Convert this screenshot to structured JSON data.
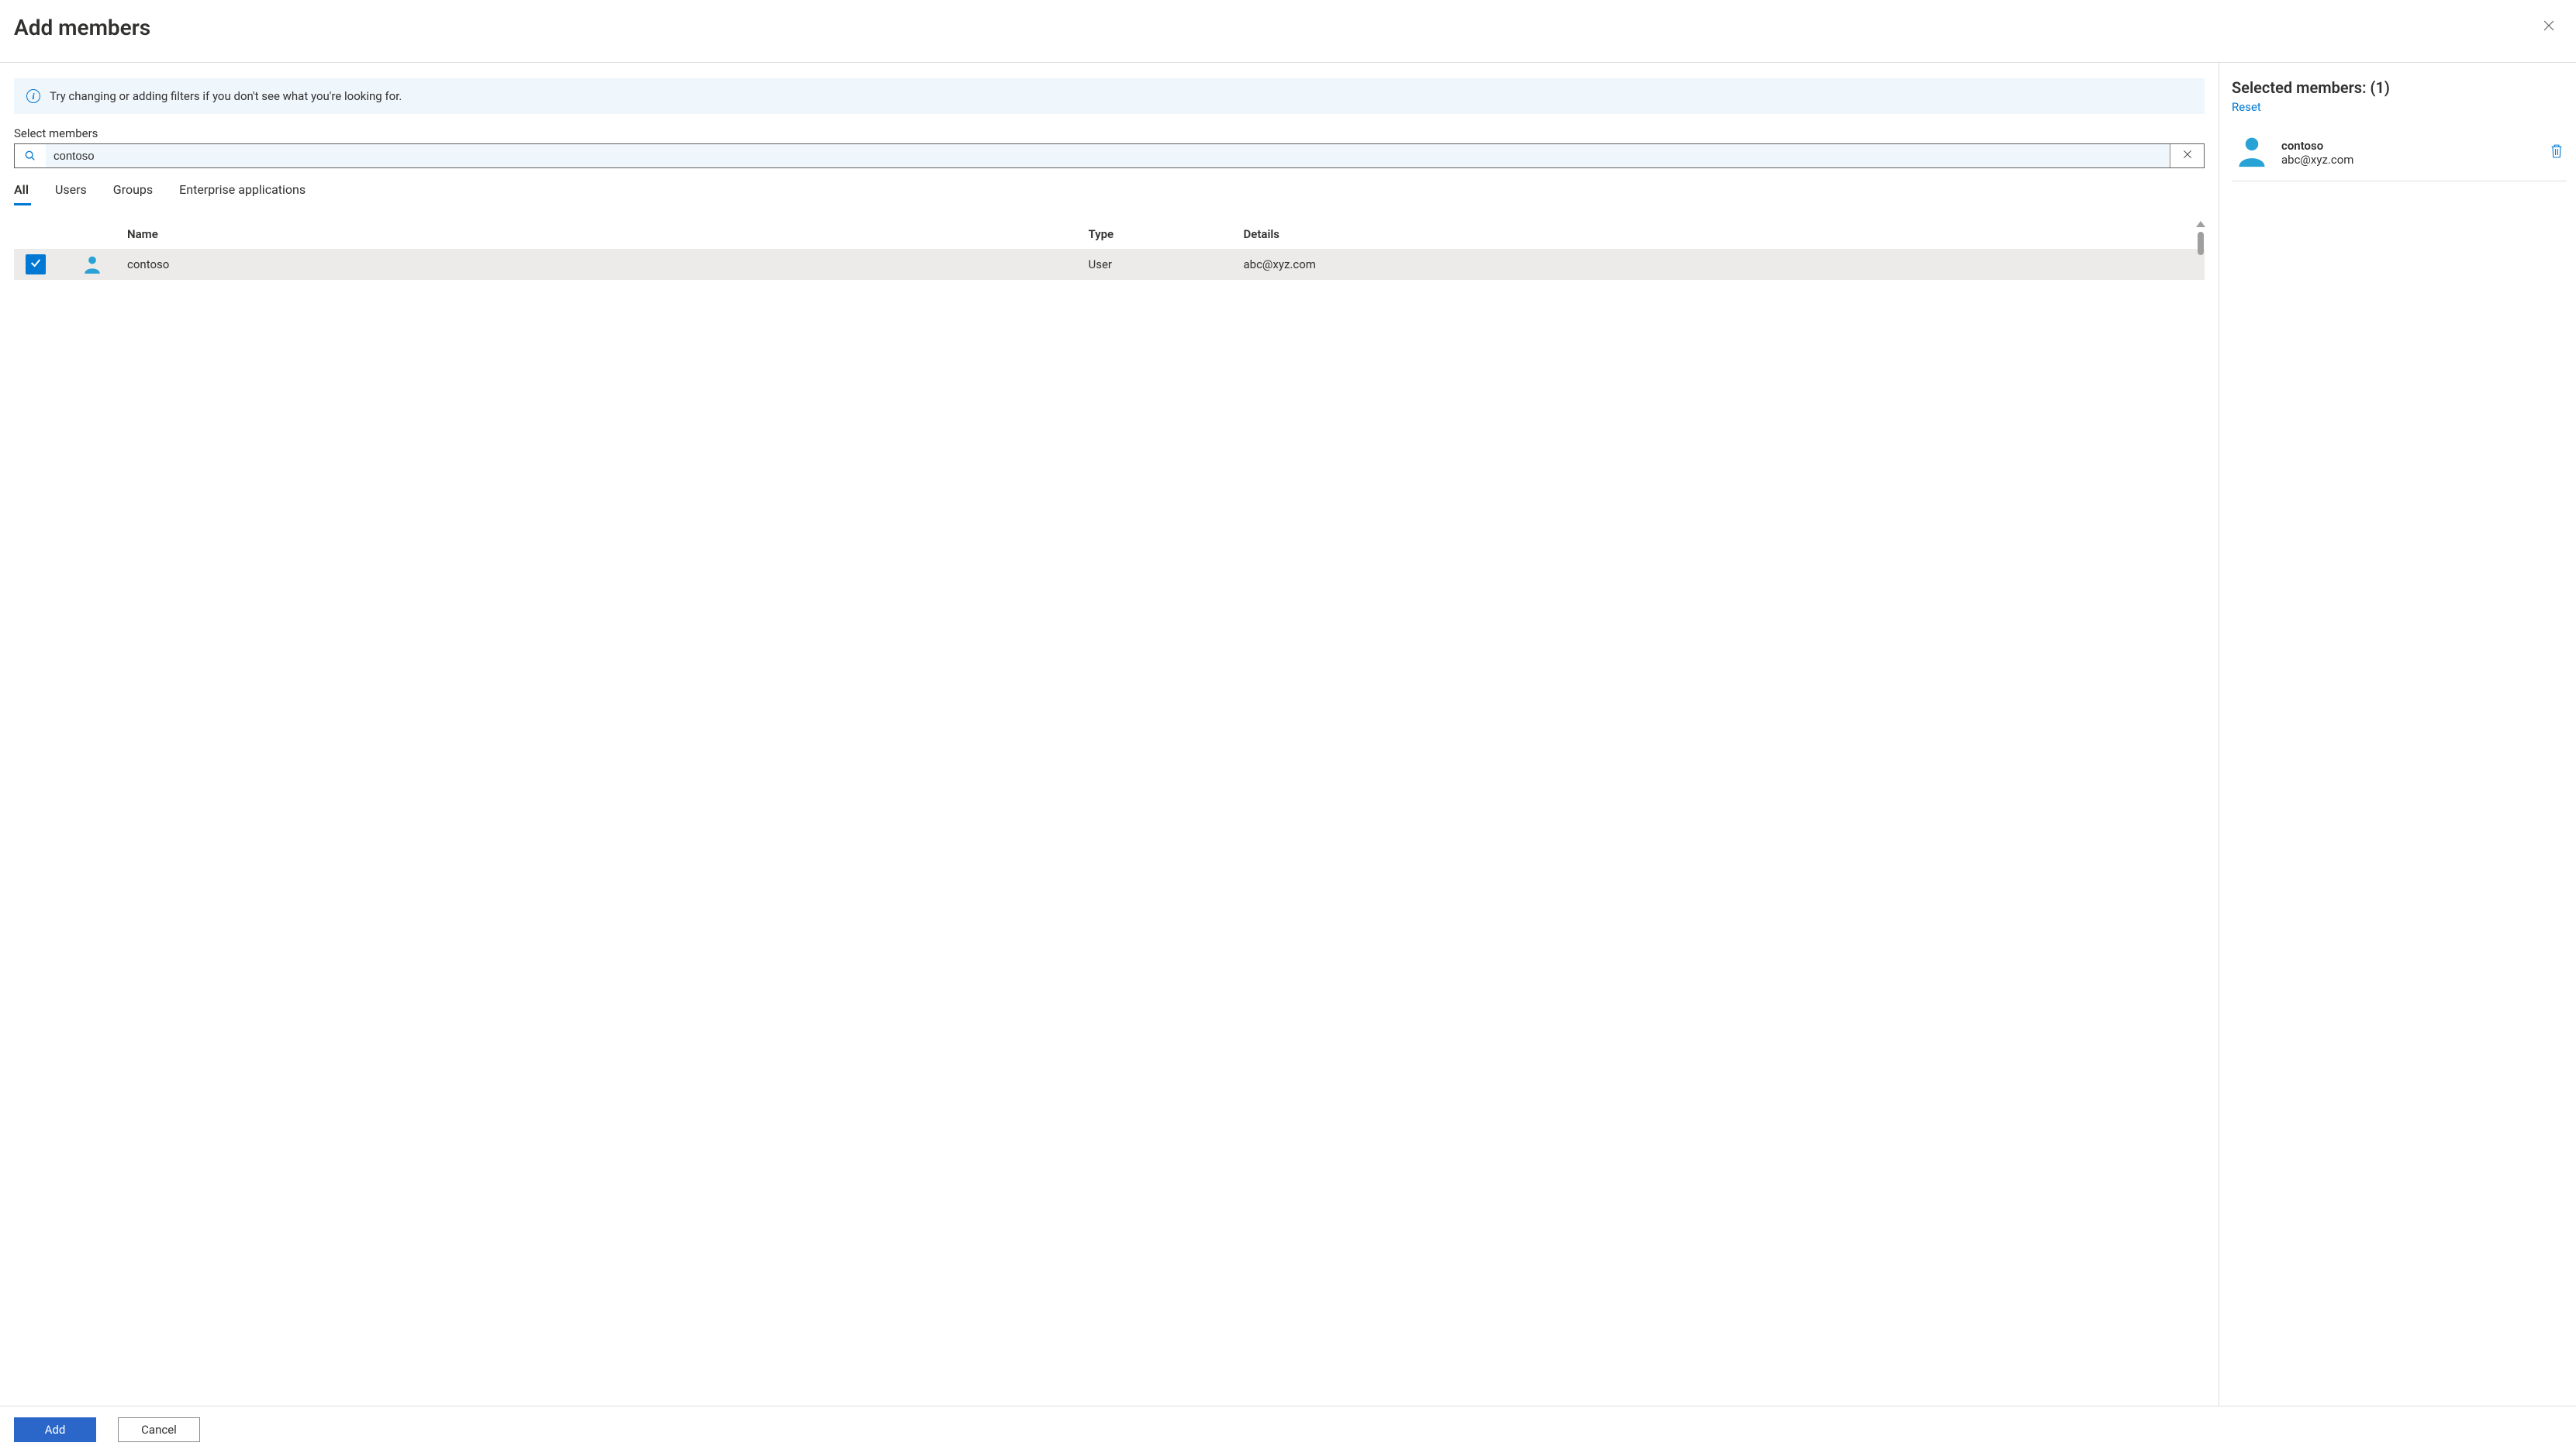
{
  "header": {
    "title": "Add members"
  },
  "info": {
    "message": "Try changing or adding filters if you don't see what you're looking for."
  },
  "search": {
    "label": "Select members",
    "value": "contoso"
  },
  "tabs": [
    {
      "label": "All",
      "active": true
    },
    {
      "label": "Users",
      "active": false
    },
    {
      "label": "Groups",
      "active": false
    },
    {
      "label": "Enterprise applications",
      "active": false
    }
  ],
  "columns": {
    "name": "Name",
    "type": "Type",
    "details": "Details"
  },
  "results": [
    {
      "name": "contoso",
      "type": "User",
      "details": "abc@xyz.com",
      "checked": true
    }
  ],
  "right": {
    "title_prefix": "Selected members:",
    "count_display": "(1)",
    "reset": "Reset",
    "selected": [
      {
        "name": "contoso",
        "email": "abc@xyz.com"
      }
    ]
  },
  "footer": {
    "add": "Add",
    "cancel": "Cancel"
  }
}
